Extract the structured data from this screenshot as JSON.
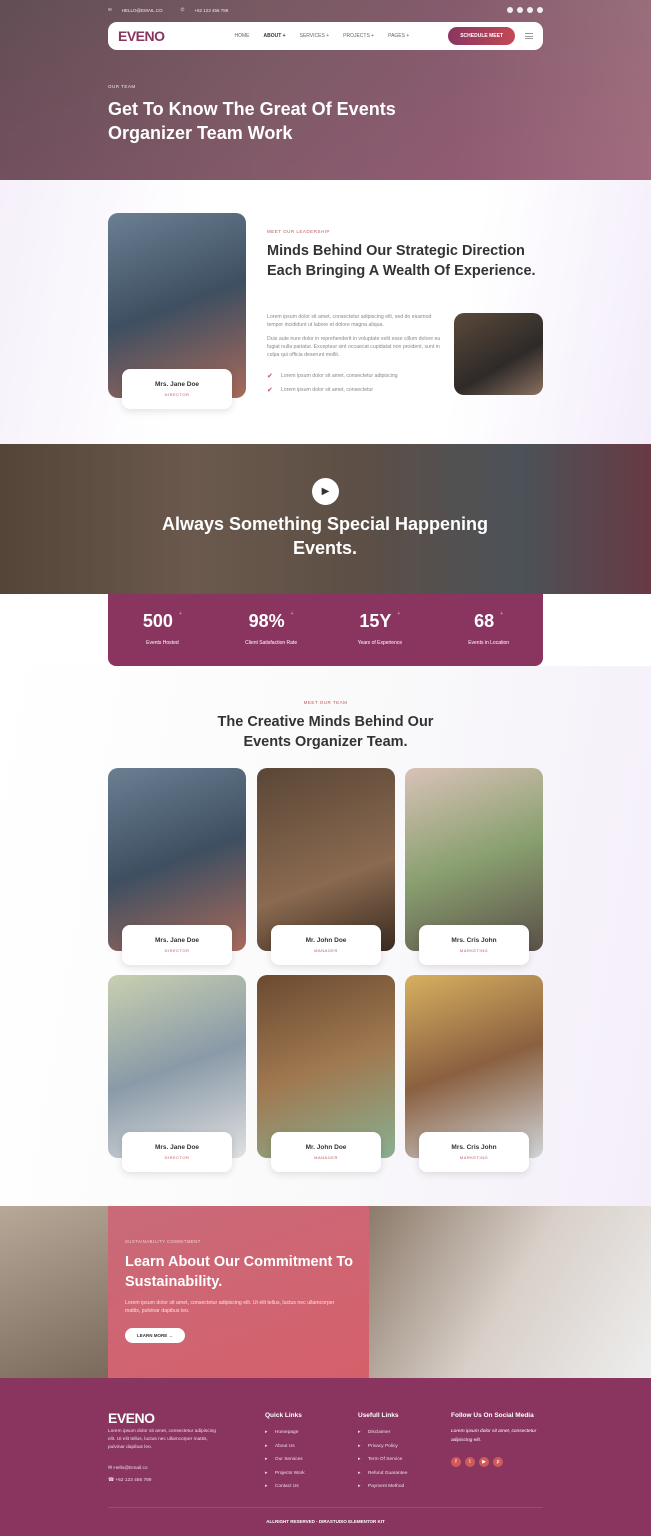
{
  "topbar": {
    "email": "HELLO@EMAIL.CO",
    "phone": "+62 123 456 789",
    "social_icons": [
      "facebook-icon",
      "twitter-icon",
      "youtube-icon",
      "pinterest-icon"
    ]
  },
  "nav": {
    "logo": "EVENO",
    "items": [
      "HOME",
      "ABOUT +",
      "SERVICES +",
      "PROJECTS +",
      "PAGES +"
    ],
    "active": "ABOUT +",
    "cta": "SCHEDULE MEET"
  },
  "hero": {
    "tag": "OUR TEAM",
    "title": "Get To Know The Great Of Events Organizer Team Work"
  },
  "leadership": {
    "eyebrow": "MEET OUR LEADERSHIP",
    "title": "Minds Behind Our Strategic Direction Each Bringing A Wealth Of Experience.",
    "p1": "Lorem ipsum dolor sit amet, consectetur adipiscing elit, sed do eiusmod tempor incididunt ut labore et dolore magna aliqua.",
    "p2": "Duis aute irure dolor in reprehenderit in voluptate velit esse cillum dolore eu fugiat nulla pariatur. Excepteur sint occaecat cupidatat non proident, sunt in culpa qui officia deserunt mollit.",
    "checks": [
      "Lorem ipsum dolor sit amet, consectetur adipiscing",
      "Lorem ipsum dolor sit amet, consectetur"
    ],
    "person": {
      "name": "Mrs. Jane Doe",
      "role": "DIRECTOR"
    }
  },
  "video": {
    "title": "Always Something Special Happening Events."
  },
  "stats": [
    {
      "value": "500",
      "label": "Events Hosted"
    },
    {
      "value": "98%",
      "label": "Client Satisfaction Rate"
    },
    {
      "value": "15Y",
      "label": "Years of Experience"
    },
    {
      "value": "68",
      "label": "Events in Location"
    }
  ],
  "stat_mark": "+",
  "team": {
    "eyebrow": "MEET OUR TEAM",
    "title": "The Creative Minds Behind Our Events Organizer Team.",
    "members": [
      {
        "name": "Mrs. Jane Doe",
        "role": "DIRECTOR"
      },
      {
        "name": "Mr. John Doe",
        "role": "MANAGER"
      },
      {
        "name": "Mrs. Cris John",
        "role": "MARKETING"
      },
      {
        "name": "Mrs. Jane Doe",
        "role": "DIRECTOR"
      },
      {
        "name": "Mr. John Doe",
        "role": "MANAGER"
      },
      {
        "name": "Mrs. Cris John",
        "role": "MARKETING"
      }
    ]
  },
  "sustainability": {
    "eyebrow": "SUSTAINABILITY COMMITMENT",
    "title": "Learn About Our Commitment To Sustainability.",
    "text": "Lorem ipsum dolor sit amet, consectetur adipiscing elit. Ut elit tellus, luctus nec ullamcorper mattis, pulvinar dapibus leo.",
    "button": "LEARN MORE →"
  },
  "footer": {
    "logo": "EVENO",
    "about": "Lorem ipsum dolor sit amet, consectetur adipiscing elit. Ut elit tellus, luctus nec ullamcorper mattis, pulvinar dapibus leo.",
    "email": "Hello@Email.co",
    "phone": "+62 123 456 789",
    "quick_title": "Quick Links",
    "quick": [
      "Homepage",
      "About Us",
      "Our Services",
      "Projects Work",
      "Contact Us"
    ],
    "useful_title": "Usefull Links",
    "useful": [
      "Disclaimer",
      "Privacy Policy",
      "Term Of Service",
      "Refund Guarantee",
      "Payment Method"
    ],
    "social_title": "Follow Us On Social Media",
    "social_text": "Lorem ipsum dolor sit amet, consectetur adipiscing elit.",
    "copyright": "ALLRIGHT RESERVED - DIRASTUDIO ELEMENTOR KIT"
  },
  "colors": {
    "primary": "#8a3560",
    "accent": "#c0585f",
    "coral": "#d05a5a"
  }
}
